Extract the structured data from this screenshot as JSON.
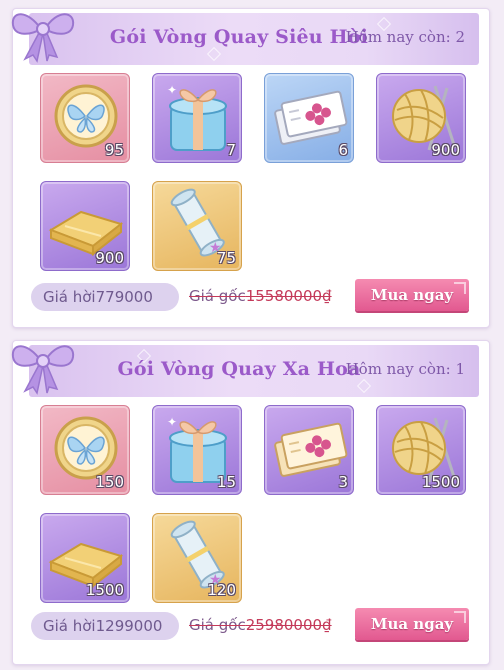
{
  "packs": [
    {
      "title": "Gói Vòng Quay Siêu Hời",
      "remaining": "Hôm nay còn: 2",
      "items": [
        {
          "icon": "butterfly-medal-icon",
          "qty": "95"
        },
        {
          "icon": "gift-box-icon",
          "qty": "7"
        },
        {
          "icon": "clover-ticket-icon",
          "qty": "6"
        },
        {
          "icon": "yarn-ball-icon",
          "qty": "900"
        },
        {
          "icon": "gold-fabric-icon",
          "qty": "900"
        },
        {
          "icon": "scroll-icon",
          "qty": "75"
        }
      ],
      "deal_price": "Giá hời779000",
      "original_label": "Giá gốc",
      "original_price": "15580000₫",
      "buy_label": "Mua ngay"
    },
    {
      "title": "Gói Vòng Quay Xa Hoa",
      "remaining": "Hôm nay còn: 1",
      "items": [
        {
          "icon": "butterfly-medal-icon",
          "qty": "150"
        },
        {
          "icon": "gift-box-icon",
          "qty": "15"
        },
        {
          "icon": "clover-ticket-icon",
          "qty": "3"
        },
        {
          "icon": "yarn-ball-icon",
          "qty": "1500"
        },
        {
          "icon": "gold-fabric-icon",
          "qty": "1500"
        },
        {
          "icon": "scroll-icon",
          "qty": "120"
        }
      ],
      "deal_price": "Giá hời1299000",
      "original_label": "Giá gốc",
      "original_price": "25980000₫",
      "buy_label": "Mua ngay"
    }
  ],
  "colors": {
    "title": "#9b5ac9",
    "buy_button": "#e25990",
    "original_price": "#c43a5a",
    "slot_pink": "#e58ea2",
    "slot_purple": "#9b76d8",
    "slot_blue": "#86aee6",
    "slot_gold": "#e6b55e"
  }
}
